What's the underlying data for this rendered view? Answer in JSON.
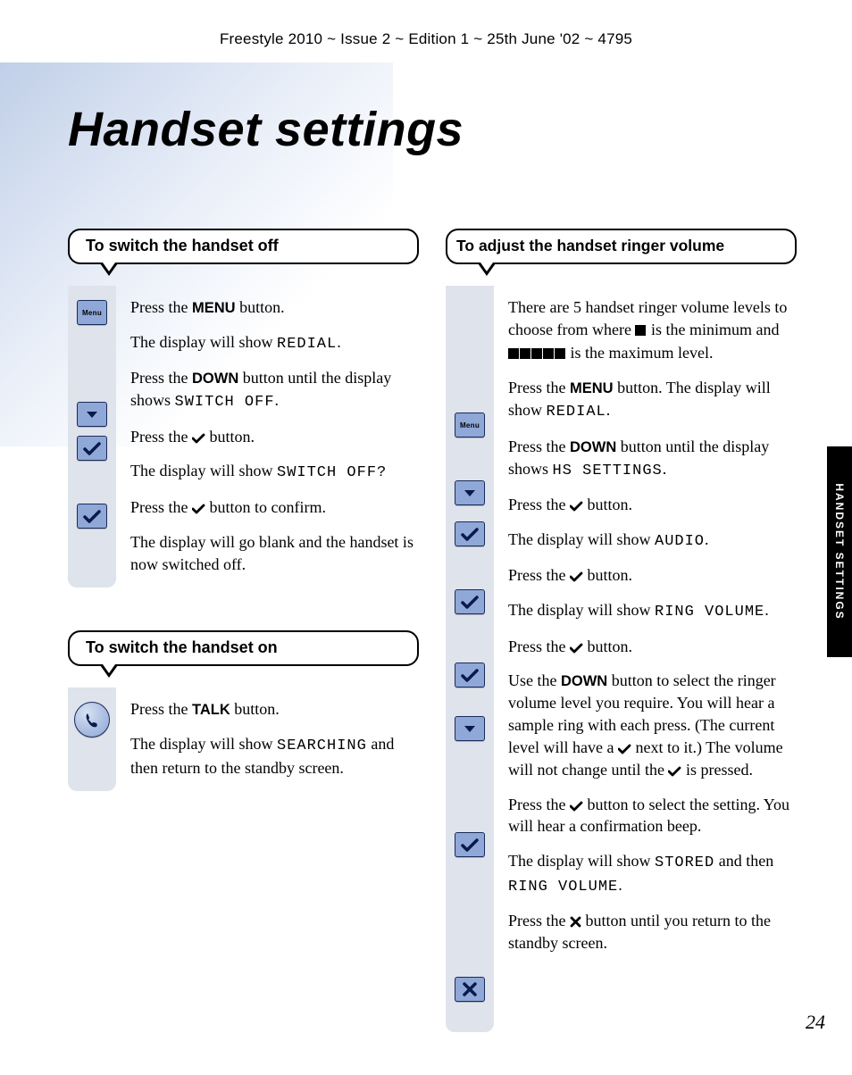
{
  "header": "Freestyle 2010 ~ Issue 2 ~ Edition 1 ~ 25th June '02 ~ 4795",
  "title": "Handset settings",
  "side_tab": "HANDSET SETTINGS",
  "page_number": "24",
  "icons": {
    "menu": "Menu"
  },
  "sec1": {
    "title": "To switch the handset off",
    "p1a": "Press the ",
    "p1b": "MENU",
    "p1c": " button.",
    "p2a": "The display will show ",
    "p2b": "REDIAL",
    "p2c": ".",
    "p3a": "Press the ",
    "p3b": "DOWN",
    "p3c": " button until the display shows ",
    "p3d": "SWITCH OFF",
    "p3e": ".",
    "p4a": "Press the ",
    "p4b": " button.",
    "p5a": "The display will show ",
    "p5b": "SWITCH OFF?",
    "p6a": "Press the ",
    "p6b": " button to confirm.",
    "p7": "The display will go blank and the handset is now switched off."
  },
  "sec2": {
    "title": "To switch the handset on",
    "p1a": "Press the ",
    "p1b": "TALK",
    "p1c": " button.",
    "p2a": "The display will show ",
    "p2b": "SEARCHING",
    "p2c": " and then return to the standby screen."
  },
  "sec3": {
    "title": "To adjust the handset ringer volume",
    "intro1": "There are 5 handset ringer volume levels to choose from where ",
    "intro2": " is the minimum and ",
    "intro3": " is the maximum level.",
    "p1a": "Press the ",
    "p1b": "MENU",
    "p1c": " button. The display will show ",
    "p1d": "REDIAL",
    "p1e": ".",
    "p2a": "Press the ",
    "p2b": "DOWN",
    "p2c": " button until the display shows ",
    "p2d": "HS SETTINGS",
    "p2e": ".",
    "p3a": "Press the ",
    "p3b": " button.",
    "p4a": "The display will show ",
    "p4b": "AUDIO",
    "p4c": ".",
    "p5a": "Press the ",
    "p5b": " button.",
    "p6a": "The display will show ",
    "p6b": "RING VOLUME",
    "p6c": ".",
    "p7a": "Press the ",
    "p7b": " button.",
    "p8a": "Use the ",
    "p8b": "DOWN",
    "p8c": " button to select the ringer volume level you require. You will hear a sample ring with each press. (The current level will have a ",
    "p8d": " next to it.) The volume will not change until the ",
    "p8e": " is pressed.",
    "p9a": "Press the ",
    "p9b": " button to select the setting. You will hear a confirmation beep.",
    "p10a": "The display will show ",
    "p10b": "STORED",
    "p10c": " and then ",
    "p10d": "RING  VOLUME",
    "p10e": ".",
    "p11a": "Press the ",
    "p11b": " button until you return to the standby screen."
  }
}
